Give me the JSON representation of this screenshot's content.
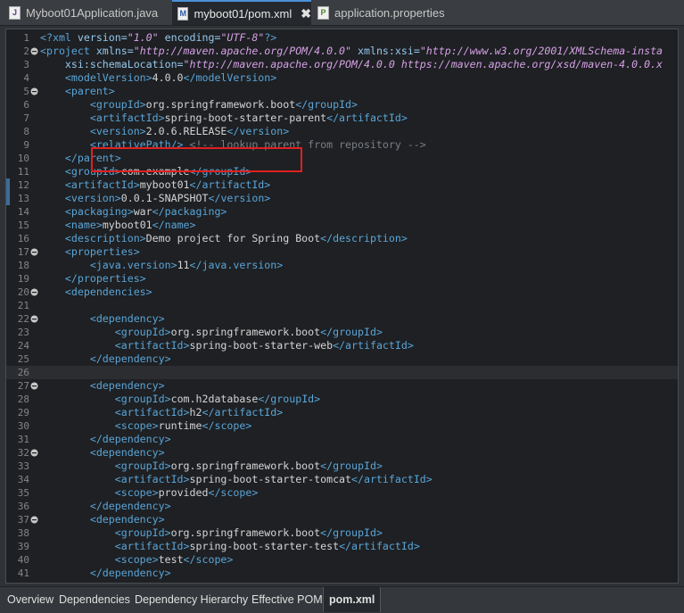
{
  "tabs": [
    {
      "label": "Myboot01Application.java",
      "icon": "java-file-icon",
      "glyph": "J"
    },
    {
      "label": "myboot01/pom.xml",
      "icon": "maven-pom-file-icon",
      "glyph": "M",
      "close": "✖"
    },
    {
      "label": "application.properties",
      "icon": "properties-file-icon",
      "glyph": "P"
    }
  ],
  "bottom_tabs": [
    "Overview",
    "Dependencies",
    "Dependency Hierarchy",
    "Effective POM",
    "pom.xml"
  ],
  "active_bottom_tab": "pom.xml",
  "highlight_color": "#e02020",
  "lines": [
    {
      "n": "1",
      "fold": "",
      "segs": [
        [
          "t",
          "<?xml "
        ],
        [
          "an",
          "version="
        ],
        [
          "av",
          "\"1.0\""
        ],
        [
          "an",
          " encoding="
        ],
        [
          "av",
          "\"UTF-8\""
        ],
        [
          "t",
          "?>"
        ]
      ]
    },
    {
      "n": "2",
      "fold": "minus",
      "segs": [
        [
          "t",
          "<project "
        ],
        [
          "an",
          "xmlns="
        ],
        [
          "av",
          "\"http://maven.apache.org/POM/4.0.0\""
        ],
        [
          "an",
          " xmlns:xsi="
        ],
        [
          "av",
          "\"http://www.w3.org/2001/XMLSchema-insta"
        ]
      ]
    },
    {
      "n": "3",
      "fold": "",
      "segs": [
        [
          "an",
          "    xsi:schemaLocation="
        ],
        [
          "av",
          "\"http://maven.apache.org/POM/4.0.0 https://maven.apache.org/xsd/maven-4.0.0.x"
        ]
      ]
    },
    {
      "n": "4",
      "fold": "",
      "segs": [
        [
          "t",
          "    <modelVersion>"
        ],
        [
          "txt",
          "4.0.0"
        ],
        [
          "t",
          "</modelVersion>"
        ]
      ]
    },
    {
      "n": "5",
      "fold": "minus",
      "segs": [
        [
          "t",
          "    <parent>"
        ]
      ]
    },
    {
      "n": "6",
      "fold": "",
      "segs": [
        [
          "t",
          "        <groupId>"
        ],
        [
          "txt",
          "org.springframework.boot"
        ],
        [
          "t",
          "</groupId>"
        ]
      ]
    },
    {
      "n": "7",
      "fold": "",
      "segs": [
        [
          "t",
          "        <artifactId>"
        ],
        [
          "txt",
          "spring-boot-starter-parent"
        ],
        [
          "t",
          "</artifactId>"
        ]
      ]
    },
    {
      "n": "8",
      "fold": "",
      "segs": [
        [
          "t",
          "        <version>"
        ],
        [
          "txt",
          "2.0.6.RELEASE"
        ],
        [
          "t",
          "</version>"
        ]
      ]
    },
    {
      "n": "9",
      "fold": "",
      "segs": [
        [
          "t",
          "        <relativePath/>"
        ],
        [
          "cm",
          " <!-- lookup parent from repository -->"
        ]
      ]
    },
    {
      "n": "10",
      "fold": "",
      "segs": [
        [
          "t",
          "    </parent>"
        ]
      ]
    },
    {
      "n": "11",
      "fold": "",
      "segs": [
        [
          "t",
          "    <groupId>"
        ],
        [
          "txt",
          "com.example"
        ],
        [
          "t",
          "</groupId>"
        ]
      ]
    },
    {
      "n": "12",
      "fold": "",
      "segs": [
        [
          "t",
          "    <artifactId>"
        ],
        [
          "txt",
          "myboot01"
        ],
        [
          "t",
          "</artifactId>"
        ]
      ],
      "marker": true
    },
    {
      "n": "13",
      "fold": "",
      "segs": [
        [
          "t",
          "    <version>"
        ],
        [
          "txt",
          "0.0.1-SNAPSHOT"
        ],
        [
          "t",
          "</version>"
        ]
      ],
      "marker": true
    },
    {
      "n": "14",
      "fold": "",
      "segs": [
        [
          "t",
          "    <packaging>"
        ],
        [
          "txt",
          "war"
        ],
        [
          "t",
          "</packaging>"
        ]
      ]
    },
    {
      "n": "15",
      "fold": "",
      "segs": [
        [
          "t",
          "    <name>"
        ],
        [
          "txt",
          "myboot01"
        ],
        [
          "t",
          "</name>"
        ]
      ]
    },
    {
      "n": "16",
      "fold": "",
      "segs": [
        [
          "t",
          "    <description>"
        ],
        [
          "txt",
          "Demo project for Spring Boot"
        ],
        [
          "t",
          "</description>"
        ]
      ]
    },
    {
      "n": "17",
      "fold": "minus",
      "segs": [
        [
          "t",
          "    <properties>"
        ]
      ]
    },
    {
      "n": "18",
      "fold": "",
      "segs": [
        [
          "t",
          "        <java.version>"
        ],
        [
          "txt",
          "11"
        ],
        [
          "t",
          "</java.version>"
        ]
      ]
    },
    {
      "n": "19",
      "fold": "",
      "segs": [
        [
          "t",
          "    </properties>"
        ]
      ]
    },
    {
      "n": "20",
      "fold": "minus",
      "segs": [
        [
          "t",
          "    <dependencies>"
        ]
      ]
    },
    {
      "n": "21",
      "fold": "",
      "segs": []
    },
    {
      "n": "22",
      "fold": "minus",
      "segs": [
        [
          "t",
          "        <dependency>"
        ]
      ]
    },
    {
      "n": "23",
      "fold": "",
      "segs": [
        [
          "t",
          "            <groupId>"
        ],
        [
          "txt",
          "org.springframework.boot"
        ],
        [
          "t",
          "</groupId>"
        ]
      ]
    },
    {
      "n": "24",
      "fold": "",
      "segs": [
        [
          "t",
          "            <artifactId>"
        ],
        [
          "txt",
          "spring-boot-starter-web"
        ],
        [
          "t",
          "</artifactId>"
        ]
      ]
    },
    {
      "n": "25",
      "fold": "",
      "segs": [
        [
          "t",
          "        </dependency>"
        ]
      ]
    },
    {
      "n": "26",
      "fold": "",
      "segs": [],
      "current": true
    },
    {
      "n": "27",
      "fold": "minus",
      "segs": [
        [
          "t",
          "        <dependency>"
        ]
      ]
    },
    {
      "n": "28",
      "fold": "",
      "segs": [
        [
          "t",
          "            <groupId>"
        ],
        [
          "txt",
          "com.h2database"
        ],
        [
          "t",
          "</groupId>"
        ]
      ]
    },
    {
      "n": "29",
      "fold": "",
      "segs": [
        [
          "t",
          "            <artifactId>"
        ],
        [
          "txt",
          "h2"
        ],
        [
          "t",
          "</artifactId>"
        ]
      ]
    },
    {
      "n": "30",
      "fold": "",
      "segs": [
        [
          "t",
          "            <scope>"
        ],
        [
          "txt",
          "runtime"
        ],
        [
          "t",
          "</scope>"
        ]
      ]
    },
    {
      "n": "31",
      "fold": "",
      "segs": [
        [
          "t",
          "        </dependency>"
        ]
      ]
    },
    {
      "n": "32",
      "fold": "minus",
      "segs": [
        [
          "t",
          "        <dependency>"
        ]
      ]
    },
    {
      "n": "33",
      "fold": "",
      "segs": [
        [
          "t",
          "            <groupId>"
        ],
        [
          "txt",
          "org.springframework.boot"
        ],
        [
          "t",
          "</groupId>"
        ]
      ]
    },
    {
      "n": "34",
      "fold": "",
      "segs": [
        [
          "t",
          "            <artifactId>"
        ],
        [
          "txt",
          "spring-boot-starter-tomcat"
        ],
        [
          "t",
          "</artifactId>"
        ]
      ]
    },
    {
      "n": "35",
      "fold": "",
      "segs": [
        [
          "t",
          "            <scope>"
        ],
        [
          "txt",
          "provided"
        ],
        [
          "t",
          "</scope>"
        ]
      ]
    },
    {
      "n": "36",
      "fold": "",
      "segs": [
        [
          "t",
          "        </dependency>"
        ]
      ]
    },
    {
      "n": "37",
      "fold": "minus",
      "segs": [
        [
          "t",
          "        <dependency>"
        ]
      ]
    },
    {
      "n": "38",
      "fold": "",
      "segs": [
        [
          "t",
          "            <groupId>"
        ],
        [
          "txt",
          "org.springframework.boot"
        ],
        [
          "t",
          "</groupId>"
        ]
      ]
    },
    {
      "n": "39",
      "fold": "",
      "segs": [
        [
          "t",
          "            <artifactId>"
        ],
        [
          "txt",
          "spring-boot-starter-test"
        ],
        [
          "t",
          "</artifactId>"
        ]
      ]
    },
    {
      "n": "40",
      "fold": "",
      "segs": [
        [
          "t",
          "            <scope>"
        ],
        [
          "txt",
          "test"
        ],
        [
          "t",
          "</scope>"
        ]
      ]
    },
    {
      "n": "41",
      "fold": "",
      "segs": [
        [
          "t",
          "        </dependency>"
        ]
      ]
    }
  ]
}
